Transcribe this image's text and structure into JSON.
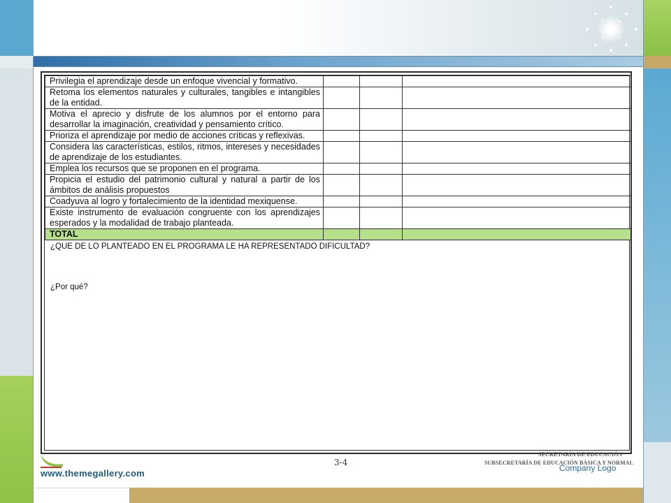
{
  "document": {
    "criteria": [
      "Privilegia el aprendizaje desde un enfoque vivencial y formativo.",
      "Retoma los elementos naturales y culturales, tangibles e intangibles de la entidad.",
      "Motiva el aprecio y disfrute de los alumnos por el entorno para desarrollar la imaginación, creatividad y pensamiento crítico.",
      "Prioriza el aprendizaje por medio de acciones críticas y reflexivas.",
      "Considera las características, estilos, ritmos, intereses y necesidades de aprendizaje de los estudiantes.",
      "Emplea los recursos que se proponen en el programa.",
      "Propicia el estudio del patrimonio cultural y natural a partir de los ámbitos de análisis propuestos",
      "Coadyuva al logro y fortalecimiento de la identidad mexiquense.",
      "Existe instrumento de evaluación congruente con los aprendizajes esperados y la modalidad de trabajo planteada."
    ],
    "total_label": "TOTAL",
    "question_1": "¿QUE DE LO PLANTEADO EN EL PROGRAMA LE HA REPRESENTADO DIFICULTAD?",
    "question_2": "¿Por qué?"
  },
  "footer": {
    "url": "www.themegallery.com",
    "page_number": "3-4",
    "company_logo": "Company Logo",
    "secretaria_line_1": "SECRETARÍA DE EDUCACIÓN",
    "secretaria_line_2": "SUBSECRETARÍA DE EDUCACIÓN BÁSICA Y NORMAL"
  },
  "colors": {
    "total_row": "#b7e08a",
    "blue_bar": "#2f6fa8",
    "green_accent": "#8fc247",
    "gold_band": "#c9ab69"
  }
}
